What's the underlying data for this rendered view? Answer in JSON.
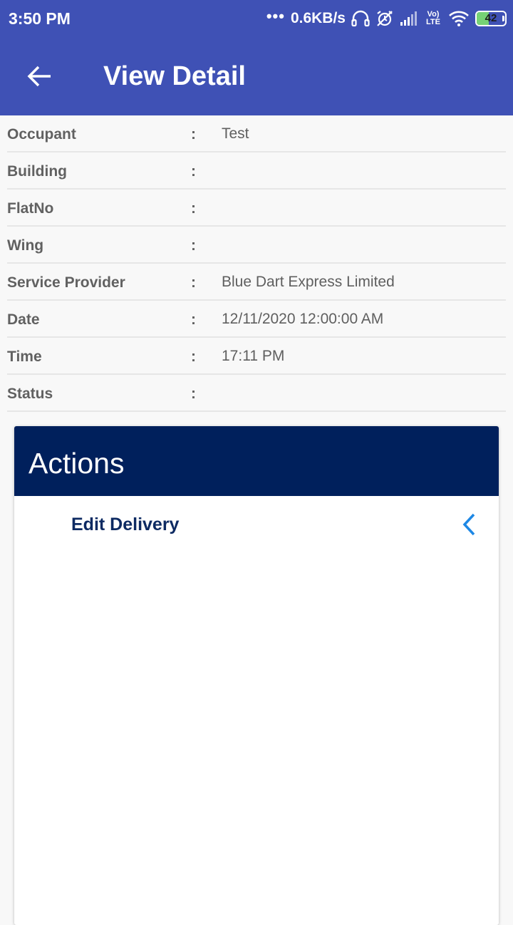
{
  "status_bar": {
    "time": "3:50 PM",
    "dots": "•••",
    "network_speed": "0.6KB/s",
    "volte_line1": "Vo)",
    "volte_line2": "LTE",
    "battery_level": "42",
    "icons": [
      "headset-icon",
      "alarm-off-icon",
      "signal-icon",
      "volte-lte-icon",
      "wifi-icon",
      "battery-icon"
    ]
  },
  "app_bar": {
    "title": "View Detail",
    "back_icon": "arrow-left-icon"
  },
  "details": [
    {
      "label": "Occupant",
      "colon": ":",
      "value": "Test"
    },
    {
      "label": "Building",
      "colon": ":",
      "value": ""
    },
    {
      "label": "FlatNo",
      "colon": ":",
      "value": ""
    },
    {
      "label": "Wing",
      "colon": ":",
      "value": ""
    },
    {
      "label": "Service Provider",
      "colon": ":",
      "value": "Blue Dart Express Limited"
    },
    {
      "label": "Date",
      "colon": ":",
      "value": "12/11/2020 12:00:00 AM"
    },
    {
      "label": "Time",
      "colon": ":",
      "value": "17:11 PM"
    },
    {
      "label": "Status",
      "colon": ":",
      "value": ""
    }
  ],
  "actions": {
    "title": "Actions",
    "items": [
      {
        "label": "Edit Delivery",
        "icon": "chevron-left-icon"
      }
    ]
  },
  "colors": {
    "app_bar": "#3f51b5",
    "actions_header": "#00205c",
    "action_label": "#0d2a62",
    "chevron": "#1e88e5",
    "battery": "#76d275"
  }
}
